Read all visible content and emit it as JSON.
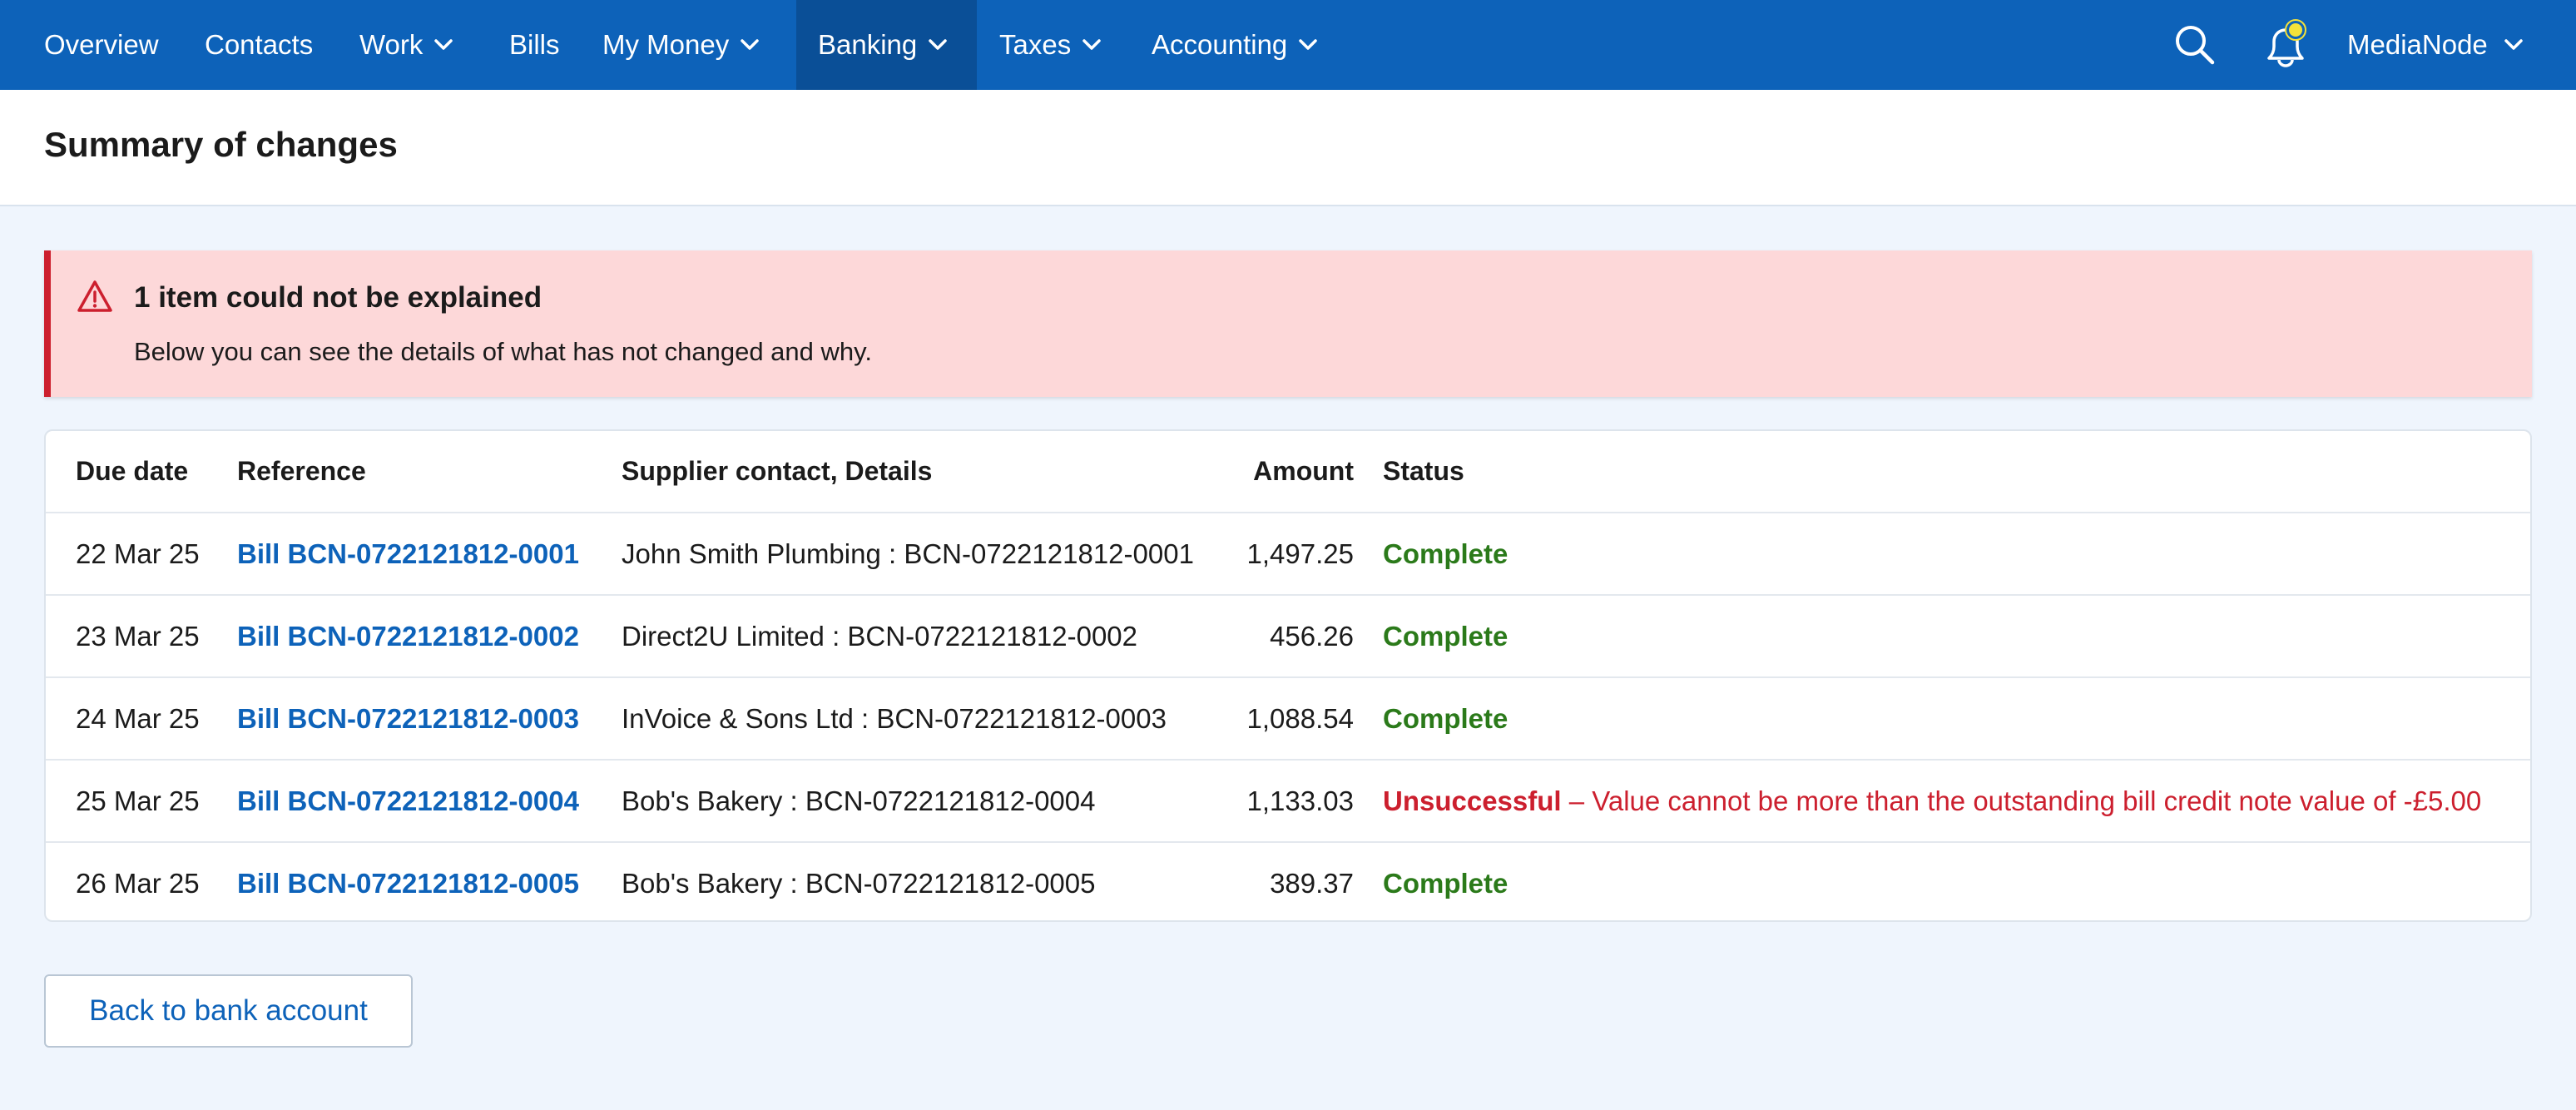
{
  "nav": {
    "items": [
      {
        "label": "Overview",
        "dropdown": false
      },
      {
        "label": "Contacts",
        "dropdown": false
      },
      {
        "label": "Work",
        "dropdown": true
      },
      {
        "label": "Bills",
        "dropdown": false
      },
      {
        "label": "My Money",
        "dropdown": true
      },
      {
        "label": "Banking",
        "dropdown": true,
        "active": true
      },
      {
        "label": "Taxes",
        "dropdown": true
      },
      {
        "label": "Accounting",
        "dropdown": true
      }
    ],
    "account_label": "MediaNode",
    "icons": [
      "search-icon",
      "bell-icon",
      "notification-dot-icon",
      "chevron-down-icon"
    ]
  },
  "header": {
    "title": "Summary of changes"
  },
  "alert": {
    "title": "1 item could not be explained",
    "text": "Below you can see the details of what has not changed and why.",
    "icon": "warning-triangle-icon"
  },
  "table": {
    "headers": {
      "due_date": "Due date",
      "reference": "Reference",
      "supplier": "Supplier contact, Details",
      "amount": "Amount",
      "status": "Status"
    },
    "rows": [
      {
        "due_date": "22 Mar 25",
        "reference": "Bill BCN-0722121812-0001",
        "supplier": "John Smith Plumbing : BCN-0722121812-0001",
        "amount": "1,497.25",
        "status": "Complete",
        "reason": ""
      },
      {
        "due_date": "23 Mar 25",
        "reference": "Bill BCN-0722121812-0002",
        "supplier": "Direct2U Limited : BCN-0722121812-0002",
        "amount": "456.26",
        "status": "Complete",
        "reason": ""
      },
      {
        "due_date": "24 Mar 25",
        "reference": "Bill BCN-0722121812-0003",
        "supplier": "InVoice & Sons Ltd : BCN-0722121812-0003",
        "amount": "1,088.54",
        "status": "Complete",
        "reason": ""
      },
      {
        "due_date": "25 Mar 25",
        "reference": "Bill BCN-0722121812-0004",
        "supplier": "Bob's Bakery : BCN-0722121812-0004",
        "amount": "1,133.03",
        "status": "Unsuccessful",
        "reason": " – Value cannot be more than the outstanding bill credit note value of -£5.00"
      },
      {
        "due_date": "26 Mar 25",
        "reference": "Bill BCN-0722121812-0005",
        "supplier": "Bob's Bakery : BCN-0722121812-0005",
        "amount": "389.37",
        "status": "Complete",
        "reason": ""
      }
    ]
  },
  "back_button": {
    "label": "Back to bank account"
  },
  "colors": {
    "nav_bg": "#0d62b9",
    "nav_active_bg": "#0a4f97",
    "link": "#0d62b9",
    "success": "#2b7a1a",
    "error": "#cc1f2e",
    "alert_bg": "#fdd8d9",
    "page_bg": "#eff5fd",
    "notification_dot": "#f4e23a"
  }
}
